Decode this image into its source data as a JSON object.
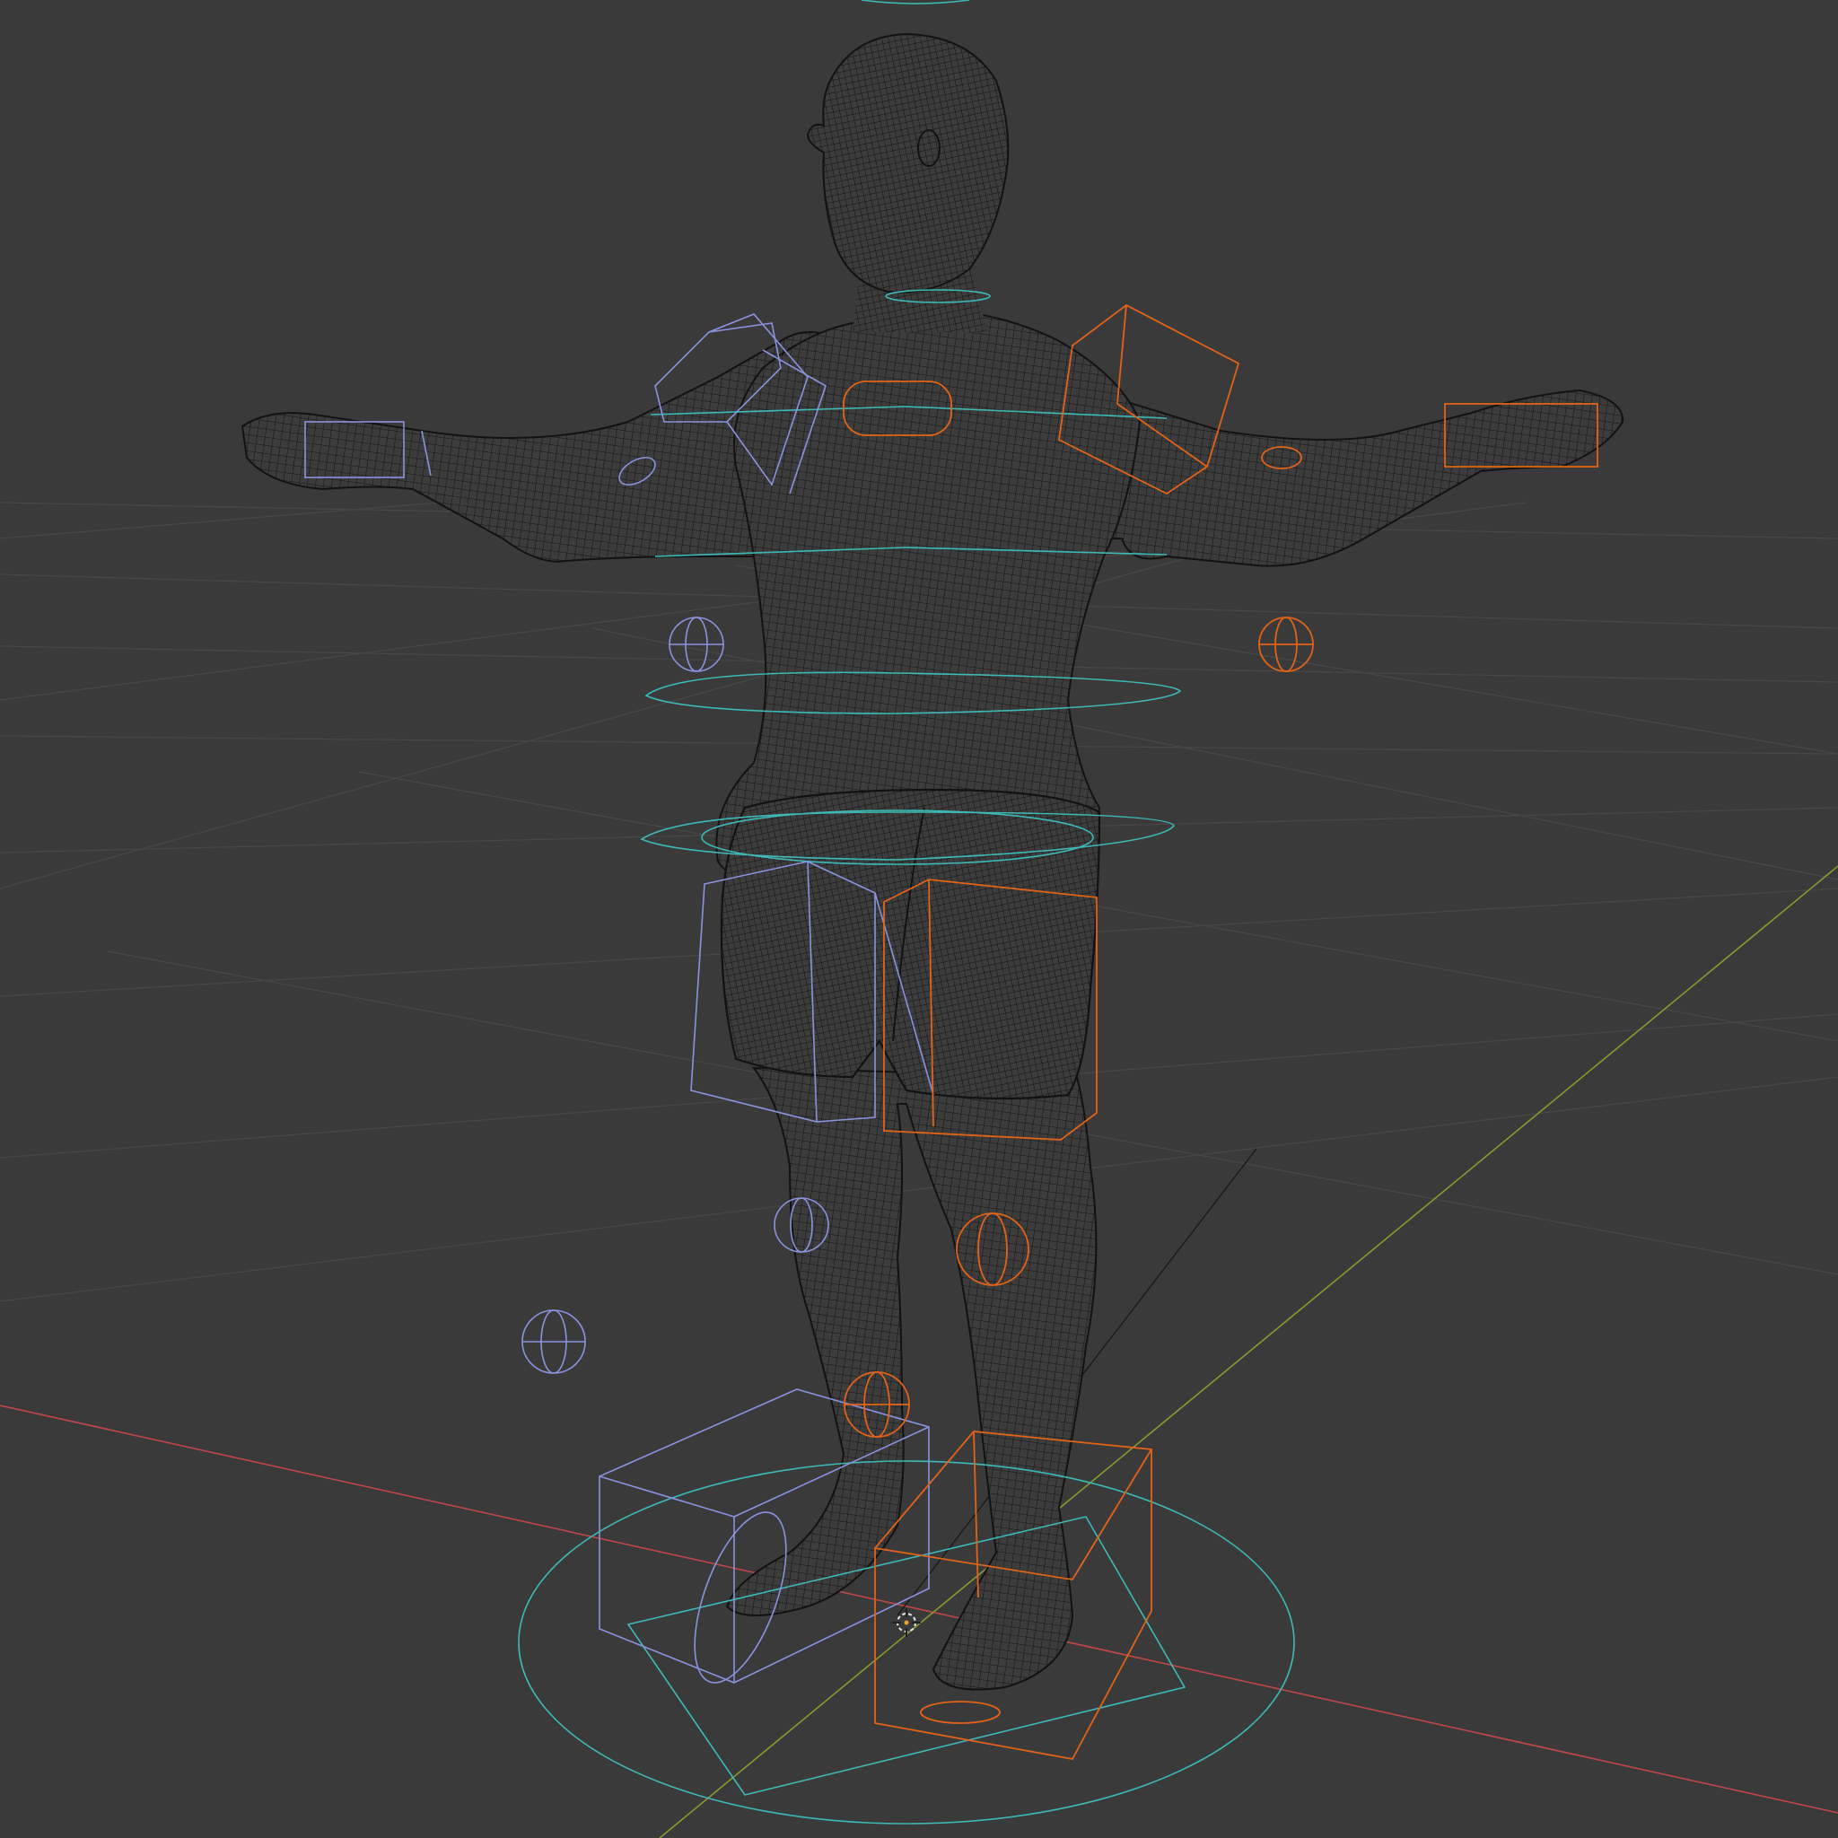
{
  "viewport": {
    "mode": "wireframe",
    "background_color": "#3a3a3a",
    "grid_color": "#474747",
    "axes": {
      "x_axis_color": "#c04848",
      "y_axis_color": "#8a9a30"
    },
    "object": {
      "type": "human-mesh-wireframe",
      "wire_color": "#121212"
    },
    "rig_controls": {
      "left_side_color": "#8a93df",
      "right_side_color": "#e0631a",
      "center_color": "#3fb8b8"
    },
    "icons": [
      "3d-cursor-icon"
    ]
  }
}
